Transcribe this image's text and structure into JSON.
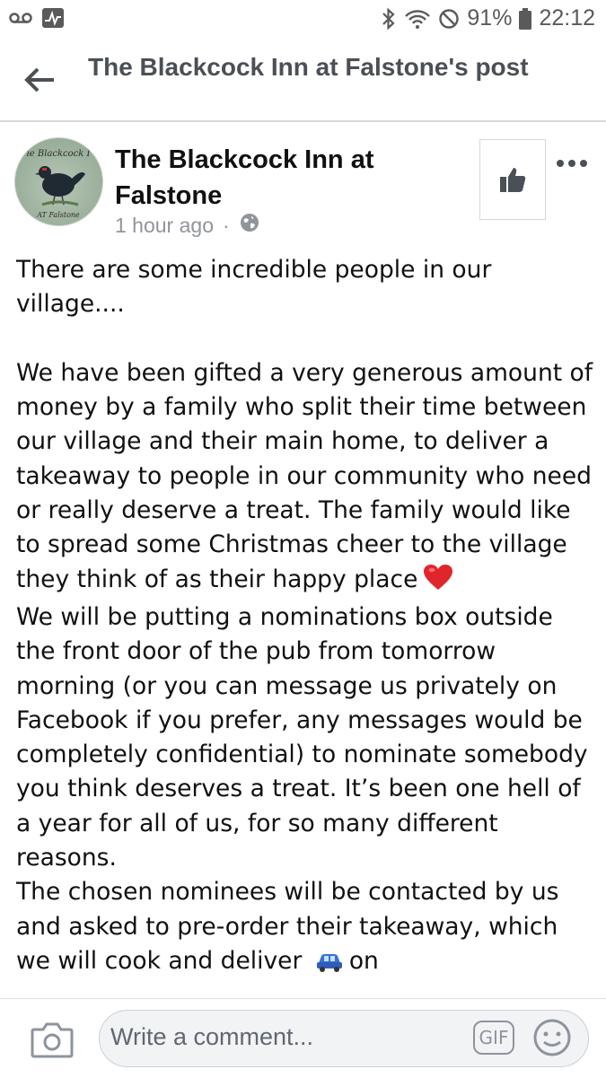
{
  "status_bar": {
    "battery": "91%",
    "time": "22:12"
  },
  "header": {
    "title": "The Blackcock Inn at Falstone's post"
  },
  "post": {
    "author": "The Blackcock Inn at Falstone",
    "time_ago": "1 hour ago",
    "separator": "·",
    "avatar_text_top": "ie Blackcock I",
    "avatar_text_bottom": "AT  Falstone",
    "paragraphs": [
      "There are some incredible people in our village....",
      "We have been gifted a very generous amount of money by a family who split their time between our village and their main home, to deliver a takeaway to people in our community who need or really deserve a treat. The family would like to spread some Christmas cheer to the village they think of as their happy place",
      "We will be putting a nominations box outside the front door of the pub from tomorrow morning (or you can message us privately on Facebook if you prefer, any messages would be completely confidential) to nominate somebody you think deserves a treat. It’s been one hell of a year for all of us, for so many different reasons.",
      "The chosen nominees will be contacted by us and asked to pre-order their takeaway, which we will cook and deliver"
    ],
    "trailing_text": "on"
  },
  "comment_bar": {
    "placeholder": "Write a comment...",
    "gif_label": "GIF"
  },
  "colors": {
    "header_text": "#4b4f56",
    "meta_text": "#90949c",
    "heart": "#e0262d"
  }
}
